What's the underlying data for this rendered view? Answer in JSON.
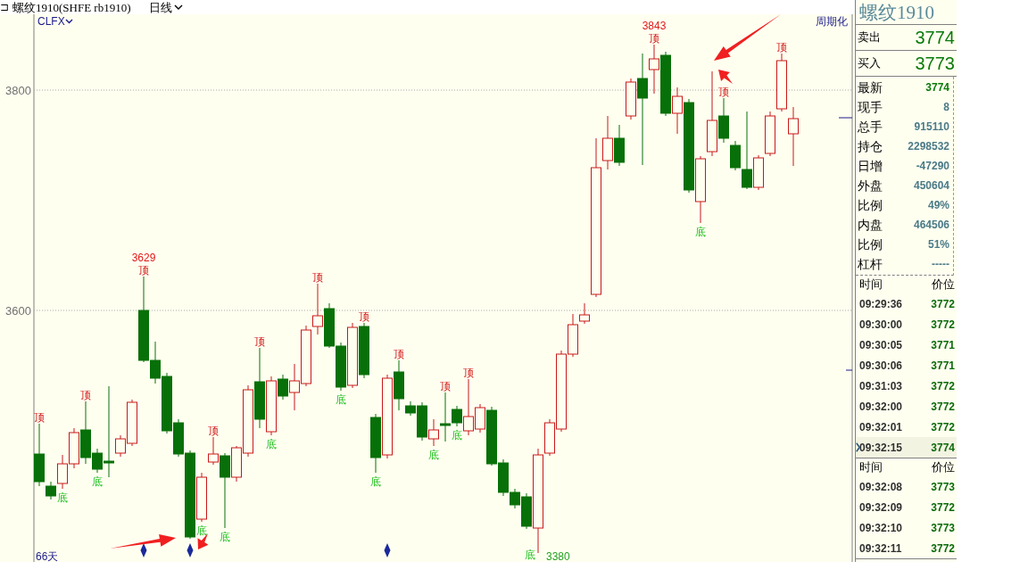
{
  "title_bar": {
    "icon": "⊐",
    "title": "螺纹1910(SHFE rb1910)",
    "period": "日线"
  },
  "chart": {
    "indicator": "CLFX",
    "mode_button": "周期化",
    "y_ticks": [
      "3800",
      "3600"
    ],
    "day_count": "66天",
    "signals": [
      {
        "kind": "top",
        "label": "顶"
      },
      {
        "kind": "bottom",
        "label": "底"
      },
      {
        "kind": "top",
        "label": "顶"
      },
      {
        "kind": "bottom",
        "label": "底"
      },
      {
        "kind": "top",
        "label": "顶"
      },
      {
        "kind": "bottom",
        "label": "底"
      },
      {
        "kind": "top",
        "label": "顶"
      },
      {
        "kind": "bottom",
        "label": "底"
      },
      {
        "kind": "top",
        "label": "顶"
      },
      {
        "kind": "bottom",
        "label": "底"
      },
      {
        "kind": "top",
        "label": "顶"
      },
      {
        "kind": "bottom",
        "label": "底"
      },
      {
        "kind": "top",
        "label": "顶"
      },
      {
        "kind": "bottom",
        "label": "底"
      },
      {
        "kind": "top",
        "label": "顶"
      },
      {
        "kind": "bottom",
        "label": "底"
      },
      {
        "kind": "top",
        "label": "顶"
      },
      {
        "kind": "bottom",
        "label": "底"
      },
      {
        "kind": "top",
        "label": "顶"
      },
      {
        "kind": "bottom",
        "label": "底"
      },
      {
        "kind": "top",
        "label": "顶"
      },
      {
        "kind": "bottom",
        "label": "底"
      },
      {
        "kind": "top",
        "label": "顶"
      },
      {
        "kind": "top",
        "label": "顶"
      }
    ],
    "price_marks": [
      {
        "kind": "high",
        "label": "3629"
      },
      {
        "kind": "low",
        "label": "3380"
      },
      {
        "kind": "high",
        "label": "3843"
      }
    ]
  },
  "quote": {
    "name": "螺纹1910",
    "ask": {
      "label": "卖出",
      "value": "3774"
    },
    "bid": {
      "label": "买入",
      "value": "3773"
    },
    "stats": [
      {
        "label": "最新",
        "value": "3774",
        "kind": "last"
      },
      {
        "label": "现手",
        "value": "8",
        "kind": "plain"
      },
      {
        "label": "总手",
        "value": "915110",
        "kind": "plain"
      },
      {
        "label": "持仓",
        "value": "2298532",
        "kind": "plain"
      },
      {
        "label": "日增",
        "value": "-47290",
        "kind": "plain"
      },
      {
        "label": "外盘",
        "value": "450604",
        "kind": "plain"
      },
      {
        "label": "比例",
        "value": "49%",
        "kind": "plain"
      },
      {
        "label": "内盘",
        "value": "464506",
        "kind": "plain"
      },
      {
        "label": "比例",
        "value": "51%",
        "kind": "plain"
      },
      {
        "label": "杠杆",
        "value": "-----",
        "kind": "plain"
      }
    ],
    "trade_lists": [
      {
        "headers": [
          "时间",
          "价位"
        ],
        "rows": [
          {
            "time": "09:29:36",
            "price": "3772",
            "selected": false
          },
          {
            "time": "09:30:00",
            "price": "3772",
            "selected": false
          },
          {
            "time": "09:30:05",
            "price": "3771",
            "selected": false
          },
          {
            "time": "09:30:06",
            "price": "3771",
            "selected": false
          },
          {
            "time": "09:31:03",
            "price": "3772",
            "selected": false
          },
          {
            "time": "09:32:00",
            "price": "3772",
            "selected": false
          },
          {
            "time": "09:32:01",
            "price": "3772",
            "selected": false
          },
          {
            "time": "09:32:15",
            "price": "3774",
            "selected": true
          }
        ]
      },
      {
        "headers": [
          "时间",
          "价位"
        ],
        "rows": [
          {
            "time": "09:32:08",
            "price": "3773",
            "selected": false
          },
          {
            "time": "09:32:09",
            "price": "3772",
            "selected": false
          },
          {
            "time": "09:32:10",
            "price": "3773",
            "selected": false
          },
          {
            "time": "09:32:11",
            "price": "3772",
            "selected": false
          }
        ]
      }
    ]
  }
}
